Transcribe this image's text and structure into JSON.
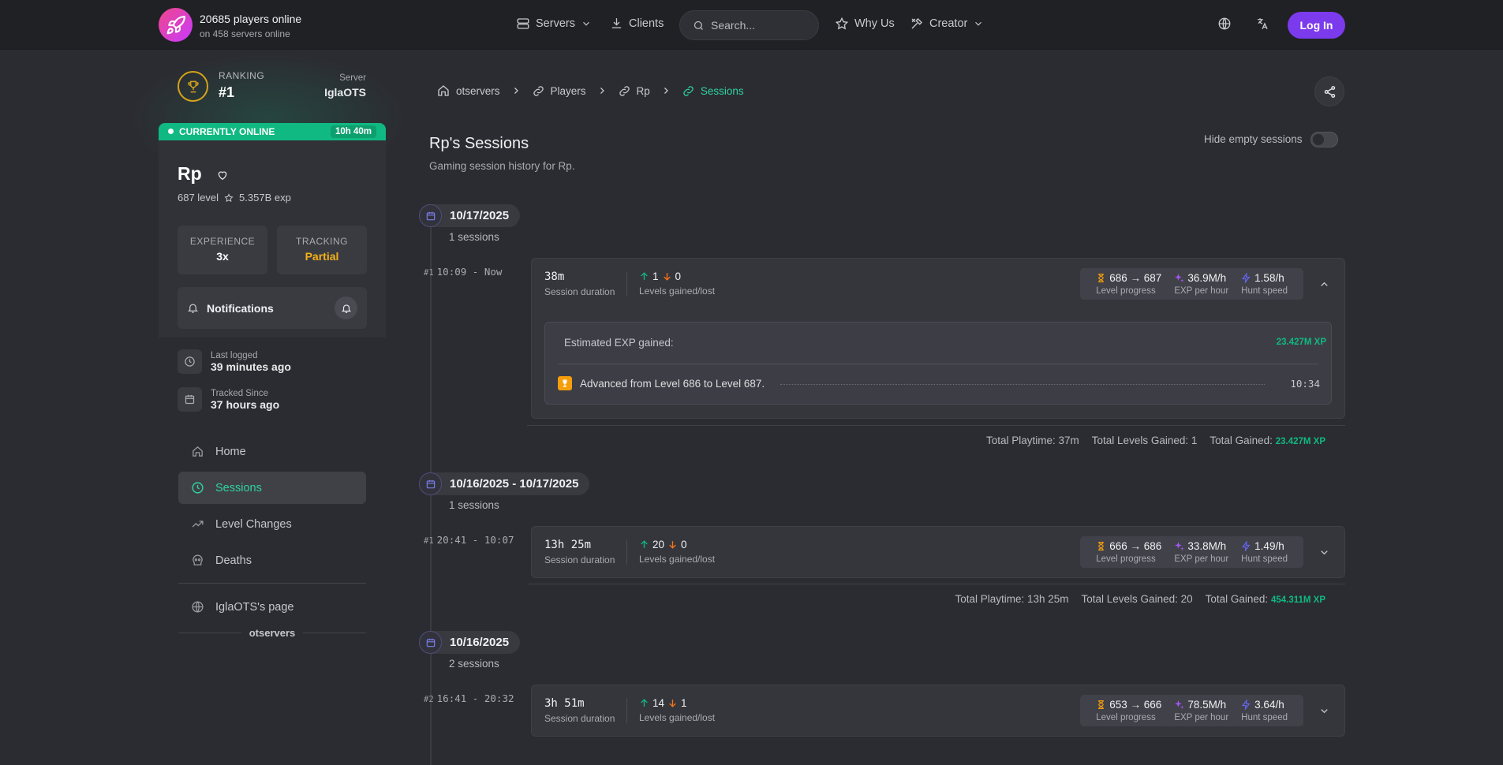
{
  "header": {
    "players_online": "20685 players online",
    "servers_online": "on 458 servers online",
    "nav": {
      "servers": "Servers",
      "clients": "Clients",
      "why_us": "Why Us",
      "creator": "Creator"
    },
    "search_placeholder": "Search...",
    "login": "Log In"
  },
  "sidebar": {
    "ranking_label": "RANKING",
    "ranking_value": "#1",
    "server_label": "Server",
    "server_value": "IglaOTS",
    "online_status": "CURRENTLY ONLINE",
    "online_time": "10h 40m",
    "player_name": "Rp",
    "level": "687 level",
    "exp": "5.357B exp",
    "experience_label": "EXPERIENCE",
    "experience_value": "3x",
    "tracking_label": "TRACKING",
    "tracking_value": "Partial",
    "notifications": "Notifications",
    "last_logged_label": "Last logged",
    "last_logged_value": "39 minutes ago",
    "tracked_since_label": "Tracked Since",
    "tracked_since_value": "37 hours ago",
    "menu": [
      {
        "label": "Home"
      },
      {
        "label": "Sessions"
      },
      {
        "label": "Level Changes"
      },
      {
        "label": "Deaths"
      }
    ],
    "server_page": "IglaOTS's page",
    "site_label": "otservers",
    "colors": {
      "online": "#10b981",
      "tracking": "#f5b017",
      "rank_ring": "#d6a21b"
    }
  },
  "main": {
    "breadcrumb": [
      "otservers",
      "Players",
      "Rp",
      "Sessions"
    ],
    "title": "Rp's Sessions",
    "subtitle": "Gaming session history for Rp.",
    "hide_empty": "Hide empty sessions",
    "groups": [
      {
        "date": "10/17/2025",
        "count": "1 sessions",
        "sessions": [
          {
            "num": "#1",
            "time": "10:09 - Now",
            "duration": "38m",
            "duration_label": "Session duration",
            "up": "1",
            "down": "0",
            "gained_label": "Levels gained/lost",
            "level_progress": "686 → 687",
            "level_progress_label": "Level progress",
            "exp_hour": "36.9M/h",
            "exp_hour_label": "EXP per hour",
            "hunt_speed": "1.58/h",
            "hunt_speed_label": "Hunt speed",
            "estimated_label": "Estimated EXP gained:",
            "estimated_value": "23.427M XP",
            "event": "Advanced from Level 686 to Level 687.",
            "event_time": "10:34"
          }
        ],
        "totals": {
          "playtime": "Total Playtime: 37m",
          "levels": "Total Levels Gained: 1",
          "gained_label": "Total Gained:",
          "gained": "23.427M XP"
        }
      },
      {
        "date": "10/16/2025 - 10/17/2025",
        "count": "1 sessions",
        "sessions": [
          {
            "num": "#1",
            "time": "20:41 - 10:07",
            "duration": "13h 25m",
            "duration_label": "Session duration",
            "up": "20",
            "down": "0",
            "gained_label": "Levels gained/lost",
            "level_progress": "666 → 686",
            "level_progress_label": "Level progress",
            "exp_hour": "33.8M/h",
            "exp_hour_label": "EXP per hour",
            "hunt_speed": "1.49/h",
            "hunt_speed_label": "Hunt speed"
          }
        ],
        "totals": {
          "playtime": "Total Playtime: 13h 25m",
          "levels": "Total Levels Gained: 20",
          "gained_label": "Total Gained:",
          "gained": "454.311M XP"
        }
      },
      {
        "date": "10/16/2025",
        "count": "2 sessions",
        "sessions": [
          {
            "num": "#2",
            "time": "16:41 - 20:32",
            "duration": "3h 51m",
            "duration_label": "Session duration",
            "up": "14",
            "down": "1",
            "gained_label": "Levels gained/lost",
            "level_progress": "653 → 666",
            "level_progress_label": "Level progress",
            "exp_hour": "78.5M/h",
            "exp_hour_label": "EXP per hour",
            "hunt_speed": "3.64/h",
            "hunt_speed_label": "Hunt speed"
          }
        ]
      }
    ],
    "colors": {
      "accent": "#2ed3a1",
      "gain": "#10b981",
      "loss": "#f97316",
      "level_icon": "#f59e0b",
      "exp_icon": "#a855f7",
      "speed_icon": "#6366f1"
    }
  }
}
